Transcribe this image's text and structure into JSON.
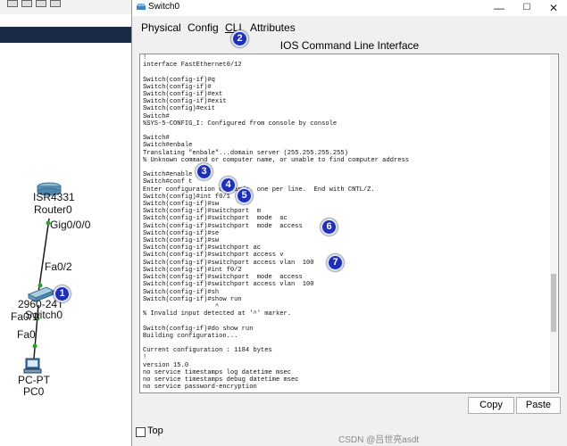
{
  "background": {
    "devices": [
      {
        "name_label": "ISR4331",
        "sub_label": "Router0"
      },
      {
        "name_label": "2960-24T",
        "sub_label": "Switch0"
      },
      {
        "name_label": "PC-PT",
        "sub_label": "PC0"
      }
    ],
    "ports": {
      "router_gig": "Gig0/0/0",
      "switch_fa02": "Fa0/2",
      "switch_fa01": "Fa0/1",
      "pc_fa0": "Fa0"
    },
    "colors": {
      "top_bar": "#1b2a47",
      "link": "#1a1a1a",
      "link_status_up": "#2ca02c"
    }
  },
  "window": {
    "title": "Switch0",
    "controls": {
      "minimize": "—",
      "maximize": "☐",
      "close": "✕"
    },
    "tabs": [
      "Physical",
      "Config",
      "CLI",
      "Attributes"
    ],
    "active_tab": "CLI",
    "heading": "IOS Command Line Interface",
    "console_lines": [
      "!",
      "interface FastEthernet0/12",
      "",
      "Switch(config-if)#q",
      "Switch(config-if)#",
      "Switch(config-if)#ext",
      "Switch(config-if)#exit",
      "Switch(config)#exit",
      "Switch#",
      "%SYS-5-CONFIG_I: Configured from console by console",
      "",
      "Switch#",
      "Switch#enbale",
      "Translating \"enbale\"...domain server (255.255.255.255)",
      "% Unknown command or computer name, or unable to find computer address",
      "",
      "Switch#enable",
      "Switch#conf t",
      "Enter configuration commands, one per line.  End with CNTL/Z.",
      "Switch(config)#int f0/1",
      "Switch(config-if)#sw",
      "Switch(config-if)#switchport  m",
      "Switch(config-if)#switchport  mode  ac",
      "Switch(config-if)#switchport  mode  access",
      "Switch(config-if)#se",
      "Switch(config-if)#sw",
      "Switch(config-if)#switchport ac",
      "Switch(config-if)#switchport access v",
      "Switch(config-if)#switchport access vlan  100",
      "Switch(config-if)#int f0/2",
      "Switch(config-if)#switchport  mode  access",
      "Switch(config-if)#switchport access vlan  100",
      "Switch(config-if)#sh",
      "Switch(config-if)#show run",
      "                   ^",
      "% Invalid input detected at '^' marker.",
      "",
      "Switch(config-if)#do show run",
      "Building configuration...",
      "",
      "Current configuration : 1184 bytes",
      "!",
      "version 15.0",
      "no service timestamps log datetime msec",
      "no service timestamps debug datetime msec",
      "no service password-encryption"
    ],
    "copy_button": "Copy",
    "paste_button": "Paste",
    "top_checkbox_label": "Top",
    "top_checked": false
  },
  "annotations": [
    "1",
    "2",
    "3",
    "4",
    "5",
    "6",
    "7"
  ],
  "watermark": "CSDN @吕世亮asdt"
}
